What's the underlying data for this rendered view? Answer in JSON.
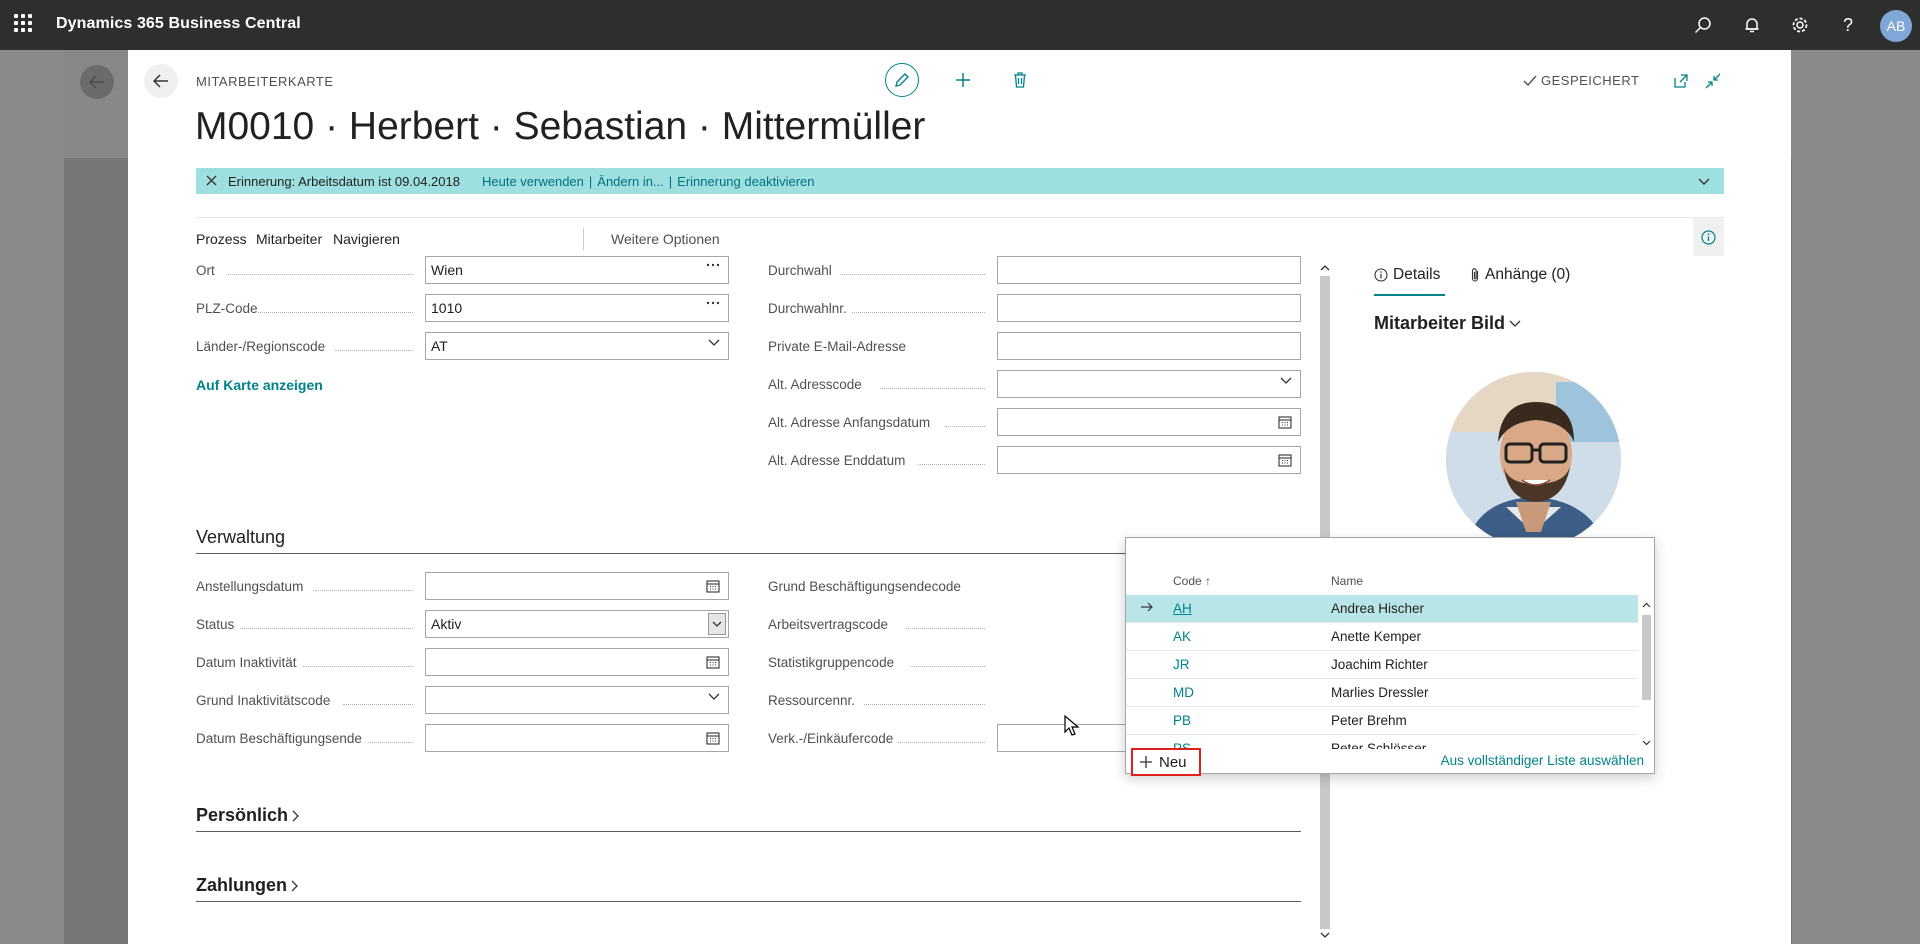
{
  "app": {
    "title": "Dynamics 365 Business Central",
    "user_initials": "AB"
  },
  "card": {
    "caption": "MITARBEITERKARTE",
    "title": "M0010 · Herbert · Sebastian · Mittermüller",
    "saved_label": "GESPEICHERT"
  },
  "reminder": {
    "message": "Erinnerung: Arbeitsdatum ist 09.04.2018",
    "link_today": "Heute verwenden",
    "link_change": "Ändern in...",
    "link_disable": "Erinnerung deaktivieren",
    "separator": "|"
  },
  "actions": {
    "process": "Prozess",
    "employee": "Mitarbeiter",
    "navigate": "Navigieren",
    "more": "Weitere Optionen"
  },
  "address": {
    "ort_label": "Ort",
    "ort_value": "Wien",
    "plz_label": "PLZ-Code",
    "plz_value": "1010",
    "land_label": "Länder-/Regionscode",
    "land_value": "AT",
    "map_link": "Auf Karte anzeigen",
    "durchwahl_label": "Durchwahl",
    "durchwahl_value": "",
    "durchwahlnr_label": "Durchwahlnr.",
    "durchwahlnr_value": "",
    "email_label": "Private E-Mail-Adresse",
    "email_value": "",
    "alt_code_label": "Alt. Adresscode",
    "alt_code_value": "",
    "alt_start_label": "Alt. Adresse Anfangsdatum",
    "alt_start_value": "",
    "alt_end_label": "Alt. Adresse Enddatum",
    "alt_end_value": ""
  },
  "verwaltung": {
    "title": "Verwaltung",
    "hire_label": "Anstellungsdatum",
    "hire_value": "",
    "status_label": "Status",
    "status_value": "Aktiv",
    "inactive_date_label": "Datum Inaktivität",
    "inactive_date_value": "",
    "inactive_reason_label": "Grund Inaktivitätscode",
    "inactive_reason_value": "",
    "term_date_label": "Datum Beschäftigungsende",
    "term_date_value": "",
    "term_reason_label": "Grund Beschäftigungsendecode",
    "contract_label": "Arbeitsvertragscode",
    "stats_label": "Statistikgruppencode",
    "resource_label": "Ressourcennr.",
    "salesperson_label": "Verk.-/Einkäufercode",
    "salesperson_value": ""
  },
  "sections": {
    "personal": "Persönlich",
    "payments": "Zahlungen"
  },
  "factbox": {
    "details_tab": "Details",
    "attachments_tab": "Anhänge (0)",
    "photo_title": "Mitarbeiter Bild"
  },
  "dropdown": {
    "col_code": "Code",
    "col_code_sort": "↑",
    "col_name": "Name",
    "rows": [
      {
        "code": "AH",
        "name": "Andrea Hischer"
      },
      {
        "code": "AK",
        "name": "Anette Kemper"
      },
      {
        "code": "JR",
        "name": "Joachim Richter"
      },
      {
        "code": "MD",
        "name": "Marlies Dressler"
      },
      {
        "code": "PB",
        "name": "Peter Brehm"
      },
      {
        "code": "PS",
        "name": "Peter Schlösser"
      }
    ],
    "new_label": "Neu",
    "full_list_label": "Aus vollständiger Liste auswählen"
  },
  "colors": {
    "accent": "#00838a",
    "reminder_bg": "#9ee0e0",
    "topbar": "#2e2e2e",
    "highlight": "#e0201a"
  }
}
